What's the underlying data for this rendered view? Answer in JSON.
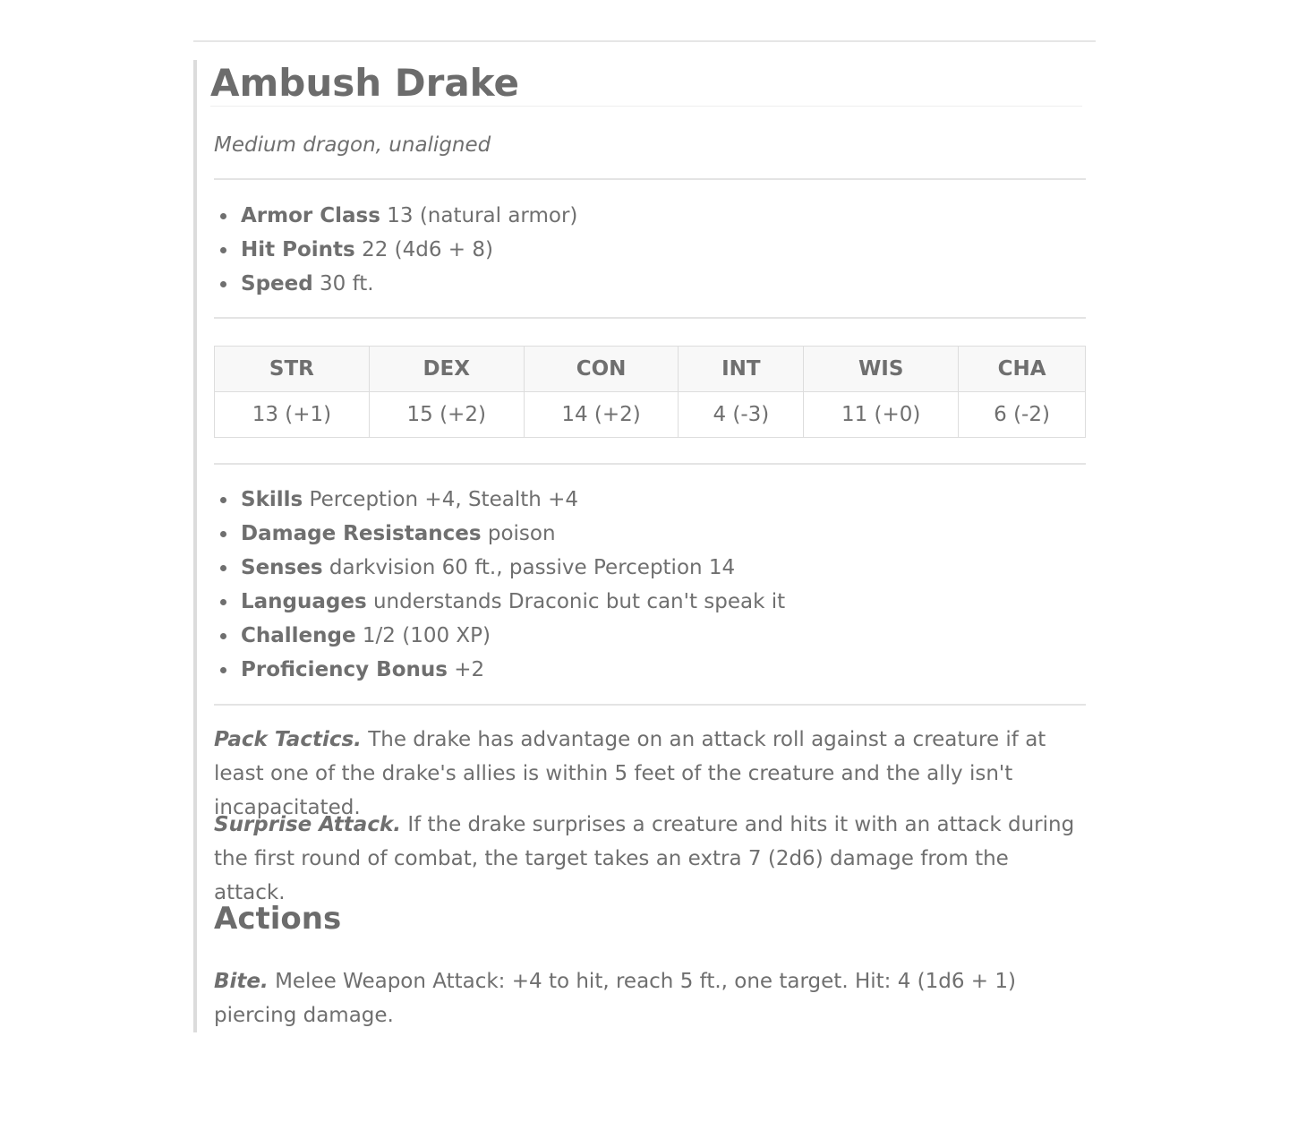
{
  "monster": {
    "name": "Ambush Drake",
    "type_line": "Medium dragon, unaligned"
  },
  "basics": [
    {
      "label": "Armor Class",
      "value": "13 (natural armor)"
    },
    {
      "label": "Hit Points",
      "value": "22 (4d6 + 8)"
    },
    {
      "label": "Speed",
      "value": "30 ft."
    }
  ],
  "abilities": {
    "headers": [
      "STR",
      "DEX",
      "CON",
      "INT",
      "WIS",
      "CHA"
    ],
    "scores": [
      "13 (+1)",
      "15 (+2)",
      "14 (+2)",
      "4 (-3)",
      "11 (+0)",
      "6 (-2)"
    ]
  },
  "details": [
    {
      "label": "Skills",
      "value": "Perception +4, Stealth +4"
    },
    {
      "label": "Damage Resistances",
      "value": "poison"
    },
    {
      "label": "Senses",
      "value": "darkvision 60 ft., passive Perception 14"
    },
    {
      "label": "Languages",
      "value": "understands Draconic but can't speak it"
    },
    {
      "label": "Challenge",
      "value": "1/2 (100 XP)"
    },
    {
      "label": "Proficiency Bonus",
      "value": "+2"
    }
  ],
  "traits": [
    {
      "name": "Pack Tactics.",
      "text": "The drake has advantage on an attack roll against a creature if at least one of the drake's allies is within 5 feet of the creature and the ally isn't incapacitated."
    },
    {
      "name": "Surprise Attack.",
      "text": "If the drake surprises a creature and hits it with an attack during the first round of combat, the target takes an extra 7 (2d6) damage from the attack."
    }
  ],
  "actions_heading": "Actions",
  "actions": [
    {
      "name": "Bite.",
      "text": "Melee Weapon Attack: +4 to hit, reach 5 ft., one target. Hit: 4 (1d6 + 1) piercing damage."
    }
  ]
}
